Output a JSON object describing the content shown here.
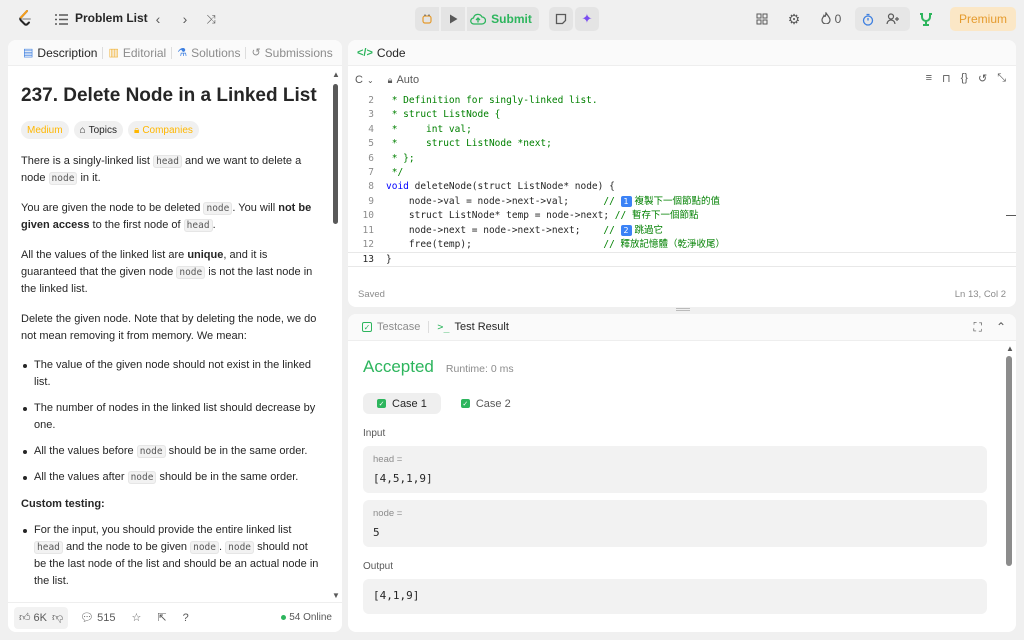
{
  "topbar": {
    "problem_list_label": "Problem List",
    "submit_label": "Submit",
    "streak_count": "0",
    "premium_label": "Premium",
    "accent_color": "#2db55d",
    "premium_color": "#e59b2e"
  },
  "left_tabs": [
    {
      "label": "Description",
      "icon": "document-icon"
    },
    {
      "label": "Editorial",
      "icon": "book-icon"
    },
    {
      "label": "Solutions",
      "icon": "flask-icon"
    },
    {
      "label": "Submissions",
      "icon": "history-icon"
    }
  ],
  "problem": {
    "title": "237. Delete Node in a Linked List",
    "difficulty": "Medium",
    "topics_label": "Topics",
    "companies_label": "Companies",
    "p1_a": "There is a singly-linked list ",
    "p1_code": "head",
    "p1_b": " and we want to delete a node ",
    "p1_code2": "node",
    "p1_c": " in it.",
    "p2_a": "You are given the node to be deleted ",
    "p2_code": "node",
    "p2_b": ". You will ",
    "p2_bold": "not be given access",
    "p2_c": " to the first node of ",
    "p2_code2": "head",
    "p2_d": ".",
    "p3_a": "All the values of the linked list are ",
    "p3_bold": "unique",
    "p3_b": ", and it is guaranteed that the given node ",
    "p3_code": "node",
    "p3_c": " is not the last node in the linked list.",
    "p4": "Delete the given node. Note that by deleting the node, we do not mean removing it from memory. We mean:",
    "b1": "The value of the given node should not exist in the linked list.",
    "b2": "The number of nodes in the linked list should decrease by one.",
    "b3_a": "All the values before ",
    "b3_code": "node",
    "b3_b": " should be in the same order.",
    "b4_a": "All the values after ",
    "b4_code": "node",
    "b4_b": " should be in the same order.",
    "custom_heading": "Custom testing:",
    "c1_a": "For the input, you should provide the entire linked list ",
    "c1_code": "head",
    "c1_b": " and the node to be given ",
    "c1_code2": "node",
    "c1_c": ". ",
    "c1_code3": "node",
    "c1_d": " should not be the last node of the list and should be an actual node in the list."
  },
  "left_footer": {
    "likes": "6K",
    "comments": "515",
    "online": "54 Online"
  },
  "code_panel": {
    "title": "Code",
    "language": "C",
    "mode": "Auto",
    "saved_label": "Saved",
    "cursor_pos": "Ln 13, Col 2",
    "line_numbers": [
      "2",
      "3",
      "4",
      "5",
      "6",
      "7",
      "8",
      "9",
      "10",
      "11",
      "12",
      "13"
    ],
    "lines": {
      "l2": " * Definition for singly-linked list.",
      "l3": " * struct ListNode {",
      "l4": " *     int val;",
      "l5": " *     struct ListNode *next;",
      "l6": " * };",
      "l7": " */",
      "l8_kw": "void",
      "l8_rest": " deleteNode(struct ListNode* node) {",
      "l9_code": "    node->val = node->next->val;      ",
      "l9_cm": "// ",
      "l9_num": "1",
      "l9_zh": " 複製下一個節點的值",
      "l10_code": "    struct ListNode* temp = node->next; ",
      "l10_cm": "// ",
      "l10_zh": "暫存下一個節點",
      "l11_code": "    node->next = node->next->next;    ",
      "l11_cm": "// ",
      "l11_num": "2",
      "l11_zh": " 跳過它",
      "l12_code": "    free(temp);                       ",
      "l12_cm": "// ",
      "l12_zh": "釋放記憶體（乾淨收尾）",
      "l13": "}"
    }
  },
  "result_panel": {
    "testcase_tab": "Testcase",
    "result_tab": "Test Result",
    "status": "Accepted",
    "runtime": "Runtime: 0 ms",
    "case1": "Case 1",
    "case2": "Case 2",
    "input_label": "Input",
    "head_name": "head =",
    "head_val": "[4,5,1,9]",
    "node_name": "node =",
    "node_val": "5",
    "output_label": "Output",
    "output_val": "[4,1,9]"
  }
}
